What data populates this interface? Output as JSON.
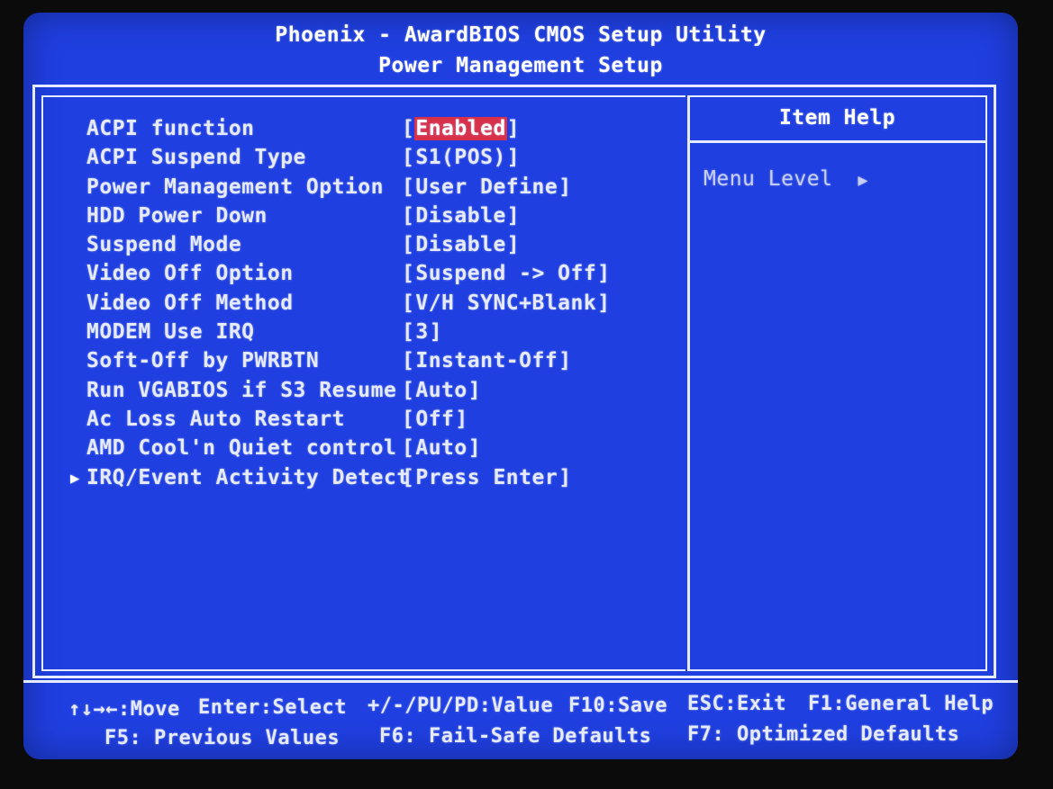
{
  "header": {
    "title": "Phoenix - AwardBIOS CMOS Setup Utility",
    "subtitle": "Power Management Setup"
  },
  "settings": [
    {
      "label": "ACPI function",
      "value": "Enabled",
      "selected": true
    },
    {
      "label": "ACPI Suspend Type",
      "value": "S1(POS)"
    },
    {
      "label": "Power Management Option",
      "value": "User Define"
    },
    {
      "label": "HDD Power Down",
      "value": "Disable"
    },
    {
      "label": "Suspend Mode",
      "value": "Disable"
    },
    {
      "label": "Video Off Option",
      "value": "Suspend -> Off"
    },
    {
      "label": "Video Off Method",
      "value": "V/H SYNC+Blank"
    },
    {
      "label": "MODEM Use IRQ",
      "value": "3"
    },
    {
      "label": "Soft-Off by PWRBTN",
      "value": "Instant-Off"
    },
    {
      "label": "Run VGABIOS if S3 Resume",
      "value": "Auto"
    },
    {
      "label": "Ac Loss Auto Restart",
      "value": "Off"
    },
    {
      "label": "AMD Cool'n Quiet control",
      "value": "Auto"
    },
    {
      "label": "IRQ/Event Activity Detect",
      "value": "Press Enter",
      "submenu": true
    }
  ],
  "help": {
    "title": "Item Help",
    "menu_level": "Menu Level"
  },
  "footer": {
    "move": "↑↓→←:Move",
    "select": "Enter:Select",
    "value": "+/-/PU/PD:Value",
    "save": "F10:Save",
    "exit": "ESC:Exit",
    "general_help": "F1:General Help",
    "previous": "F5: Previous Values",
    "failsafe": "F6: Fail-Safe Defaults",
    "optimized": "F7: Optimized Defaults"
  },
  "colors": {
    "background": "#1f3fe0",
    "text": "#e6eaff",
    "highlight": "#d8304a"
  }
}
